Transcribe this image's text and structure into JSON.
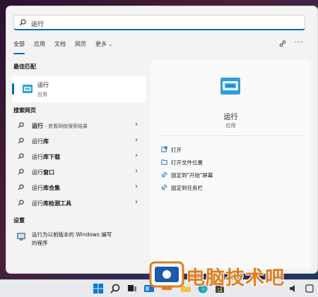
{
  "search": {
    "value": "运行"
  },
  "tabs": [
    {
      "label": "全部",
      "active": true
    },
    {
      "label": "应用"
    },
    {
      "label": "文档"
    },
    {
      "label": "网页"
    },
    {
      "label": "更多"
    }
  ],
  "best_match": {
    "heading": "最佳匹配",
    "title": "运行",
    "subtitle": "应用"
  },
  "web": {
    "heading": "搜索网页",
    "items": [
      {
        "bold": "运行",
        "rest": " - 查看网络搜索结果"
      },
      {
        "bold": "运行",
        "rest": "库"
      },
      {
        "bold": "运行",
        "rest": "库下载"
      },
      {
        "bold": "运行",
        "rest": "窗口"
      },
      {
        "bold": "运行",
        "rest": "库合集"
      },
      {
        "bold": "运行",
        "rest": "库检测工具"
      }
    ]
  },
  "settings": {
    "heading": "设置",
    "line1": "运行为以前版本的 Windows 编写",
    "line2": "的程序"
  },
  "detail": {
    "title": "运行",
    "subtitle": "应用",
    "actions": [
      {
        "label": "打开",
        "icon": "open-icon"
      },
      {
        "label": "打开文件位置",
        "icon": "folder-icon"
      },
      {
        "label": "固定到\"开始\"屏幕",
        "icon": "pin-icon"
      },
      {
        "label": "固定到任务栏",
        "icon": "pin-icon"
      }
    ]
  },
  "watermark": {
    "text": "电脑技术吧"
  },
  "colors": {
    "accent": "#0067c0",
    "watermark": "#e07d1d"
  }
}
